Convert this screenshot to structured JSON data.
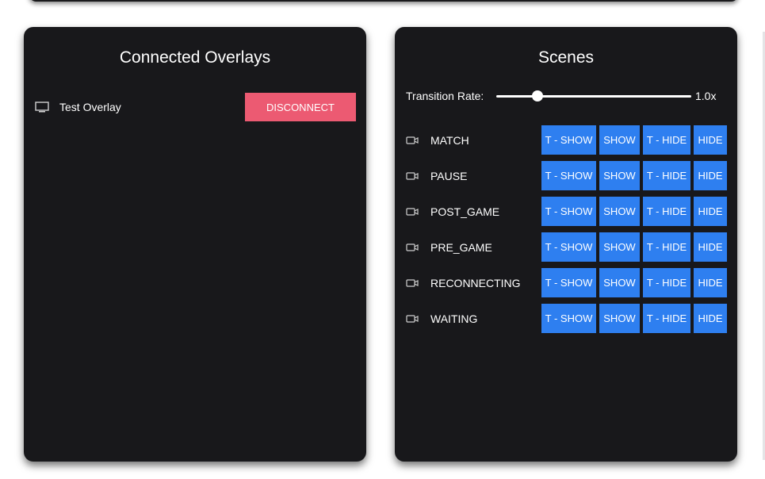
{
  "overlays_panel": {
    "title": "Connected Overlays",
    "items": [
      {
        "name": "Test Overlay",
        "icon": "monitor-icon",
        "action_label": "DISCONNECT"
      }
    ]
  },
  "scenes_panel": {
    "title": "Scenes",
    "transition": {
      "label": "Transition Rate:",
      "value_text": "1.0x",
      "slider_fraction": 0.21
    },
    "button_labels": {
      "t_show": "T - SHOW",
      "show": "SHOW",
      "t_hide": "T - HIDE",
      "hide": "HIDE"
    },
    "scenes": [
      {
        "name": "MATCH",
        "icon": "camera-icon"
      },
      {
        "name": "PAUSE",
        "icon": "camera-icon"
      },
      {
        "name": "POST_GAME",
        "icon": "camera-icon"
      },
      {
        "name": "PRE_GAME",
        "icon": "camera-icon"
      },
      {
        "name": "RECONNECTING",
        "icon": "camera-icon"
      },
      {
        "name": "WAITING",
        "icon": "camera-icon"
      }
    ]
  },
  "colors": {
    "panel_bg": "#18181b",
    "disconnect": "#ec5a72",
    "scene_button": "#2e7ff0"
  }
}
